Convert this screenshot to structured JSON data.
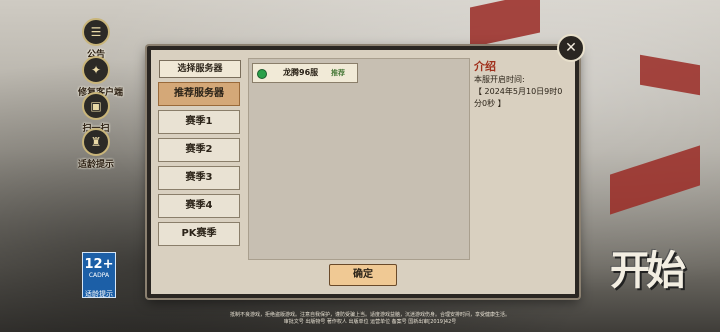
{
  "side_buttons": [
    {
      "label": "公告",
      "icon": "notice-icon",
      "glyph": "☰"
    },
    {
      "label": "修复客户端",
      "icon": "wrench-icon",
      "glyph": "✦"
    },
    {
      "label": "扫一扫",
      "icon": "scan-icon",
      "glyph": "▣"
    },
    {
      "label": "适龄提示",
      "icon": "age-info-icon",
      "glyph": "♜"
    }
  ],
  "dialog": {
    "header": "选择服务器",
    "tabs": [
      "推荐服务器",
      "赛季1",
      "赛季2",
      "赛季3",
      "赛季4",
      "PK赛季"
    ],
    "server": {
      "name": "龙腾96服",
      "tag": "推荐"
    },
    "intro": {
      "heading": "介绍",
      "line1": "本服开启时间:",
      "line2": "【 2024年5月10日9时0分0秒 】"
    },
    "confirm_label": "确定"
  },
  "close_glyph": "✕",
  "age_badge": {
    "number": "12+",
    "org": "CADPA",
    "tip": "适龄提示"
  },
  "start_label": "开始",
  "footer": {
    "line1": "抵制不良游戏，拒绝盗版游戏。注意自我保护，谨防受骗上当。适度游戏益脑，沉迷游戏伤身。合理安排时间，享受健康生活。",
    "line2": "审批文号 出版物号 著作权人 出版单位 运营单位 备案号 国新出审[2019]42号"
  },
  "colors": {
    "accent": "#a0301c",
    "active_tab": "#d4a878",
    "confirm": "#f0c994"
  }
}
